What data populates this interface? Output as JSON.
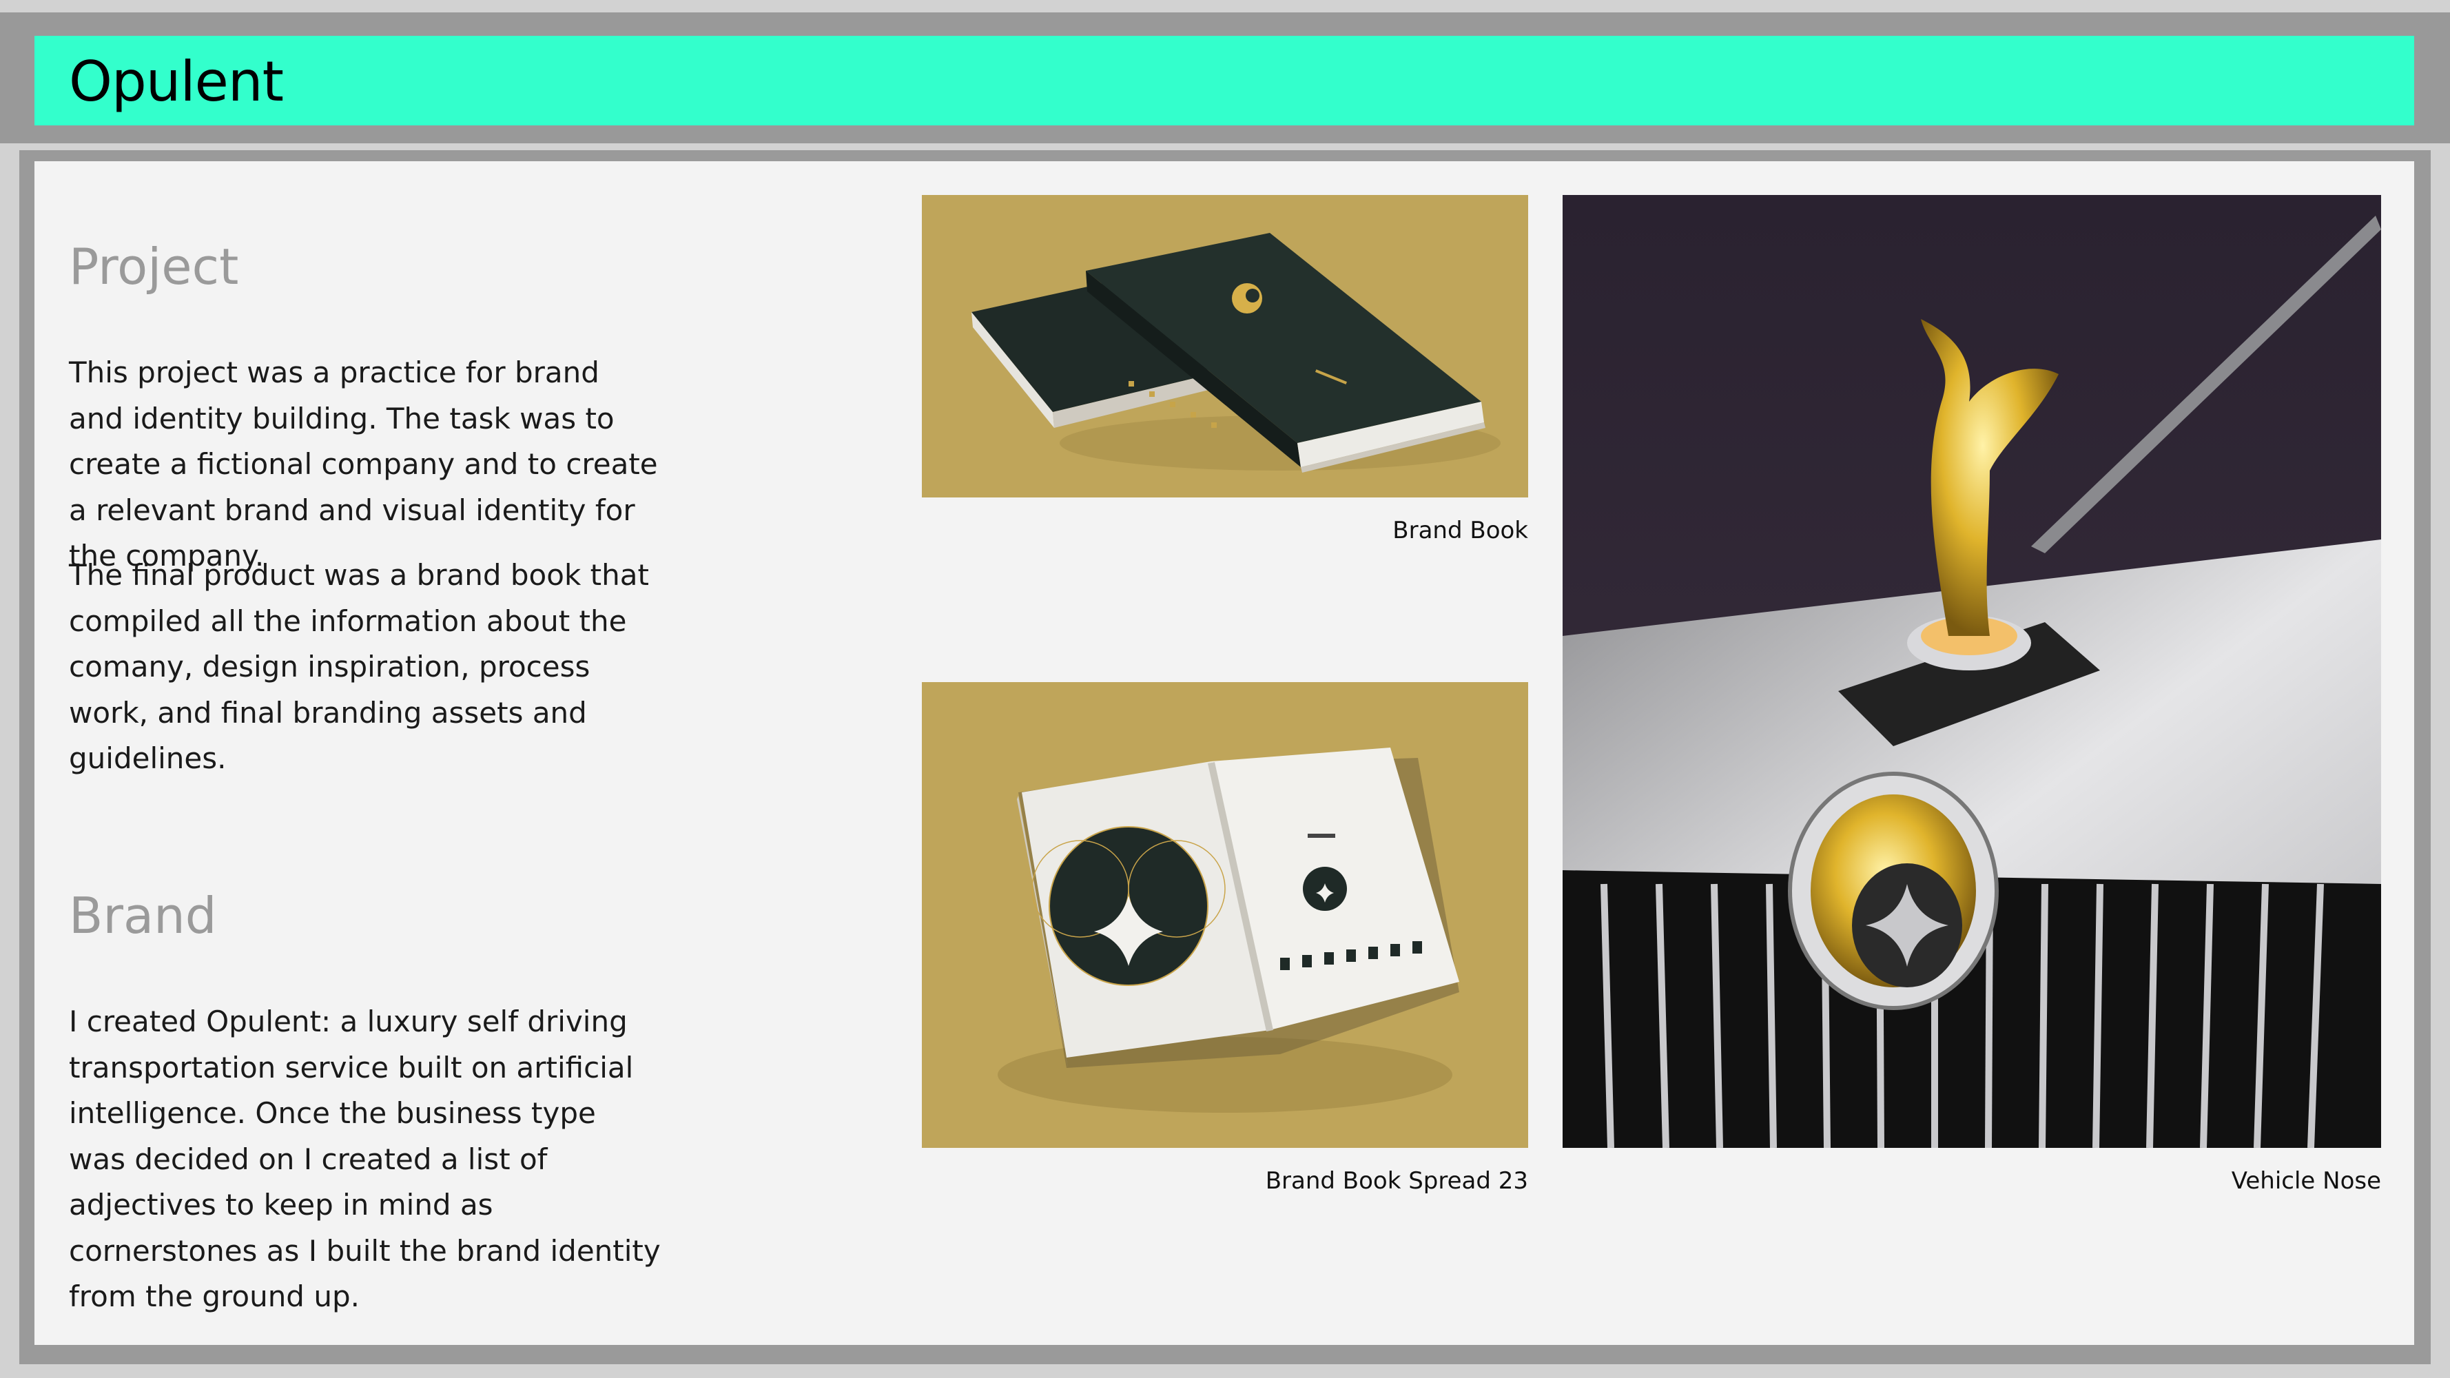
{
  "header": {
    "title": "Opulent"
  },
  "project": {
    "heading": "Project",
    "paragraph_1": "This project was a practice for brand and identity building. The task was to create a fictional company and to create a relevant brand and visual identity for the company.",
    "paragraph_2": "The final product was a brand book that compiled all the information about the comany, design inspiration, process work, and final branding assets and guidelines."
  },
  "brand": {
    "heading": "Brand",
    "paragraph": "I created Opulent: a luxury self driving transportation service built on artificial intelligence. Once the business type was decided on I created a list of adjectives to keep in mind as cornerstones as I built the brand identity from the ground up."
  },
  "gallery": {
    "brand_book_caption": "Brand Book",
    "spread_caption": "Brand Book Spread 23",
    "vehicle_caption": "Vehicle Nose"
  },
  "colors": {
    "accent": "#33ffcc",
    "mustard": "#bfa55a",
    "book_dark": "#1f2a27",
    "gold": "#d8b23a"
  }
}
